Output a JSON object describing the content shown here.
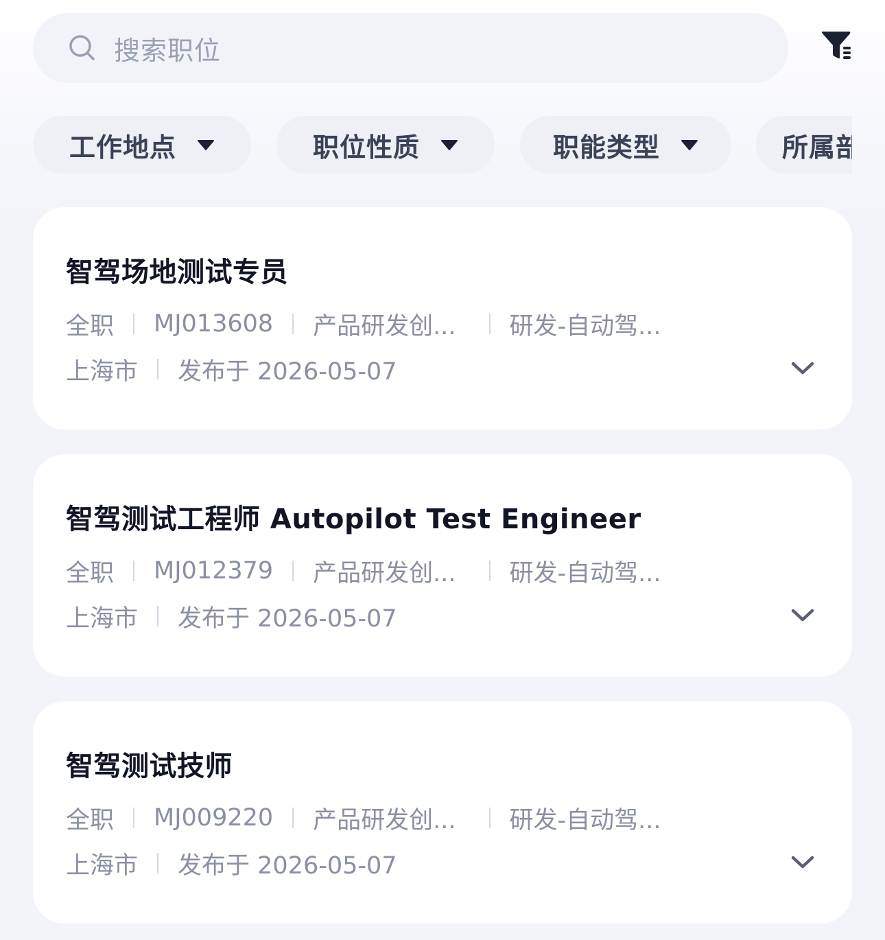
{
  "search": {
    "placeholder": "搜索职位",
    "icon": "search-icon"
  },
  "filter_button": {
    "icon": "filter-funnel-icon"
  },
  "filters": [
    {
      "label": "工作地点"
    },
    {
      "label": "职位性质"
    },
    {
      "label": "职能类型"
    },
    {
      "label": "所属部"
    }
  ],
  "jobs": [
    {
      "title": "智驾场地测试专员",
      "type": "全职",
      "code": "MJ013608",
      "department": "产品研发创...",
      "category": "研发-自动驾...",
      "city": "上海市",
      "published": "发布于 2026-05-07"
    },
    {
      "title": "智驾测试工程师 Autopilot Test Engineer",
      "type": "全职",
      "code": "MJ012379",
      "department": "产品研发创...",
      "category": "研发-自动驾...",
      "city": "上海市",
      "published": "发布于 2026-05-07"
    },
    {
      "title": "智驾测试技师",
      "type": "全职",
      "code": "MJ009220",
      "department": "产品研发创...",
      "category": "研发-自动驾...",
      "city": "上海市",
      "published": "发布于 2026-05-07"
    }
  ],
  "colors": {
    "background": "#f3f4f9",
    "card": "#ffffff",
    "title_text": "#111526",
    "meta_text": "#8a8fa3",
    "chip_bg": "#eef0f6",
    "accent_dark": "#1c2033"
  }
}
